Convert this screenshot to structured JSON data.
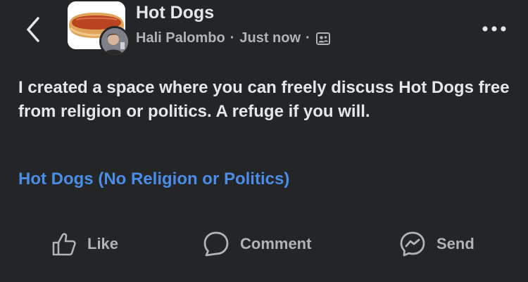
{
  "post": {
    "group_name": "Hot Dogs",
    "author": "Hali Palombo",
    "separator": "·",
    "timestamp": "Just now",
    "privacy_icon": "group-members-icon",
    "body": "I created a space where you can freely discuss Hot Dogs free from religion or politics. A refuge if you will.",
    "link_text": "Hot Dogs (No Religion or Politics)"
  },
  "actions": {
    "like_label": "Like",
    "comment_label": "Comment",
    "send_label": "Send"
  },
  "icons": {
    "back": "chevron-left-icon",
    "more": "more-dots-icon",
    "like": "thumbs-up-icon",
    "comment": "comment-bubble-icon",
    "send": "messenger-icon"
  },
  "colors": {
    "background": "#242526",
    "primary_text": "#e4e6eb",
    "secondary_text": "#b0b3b8",
    "link": "#4b8de6"
  }
}
